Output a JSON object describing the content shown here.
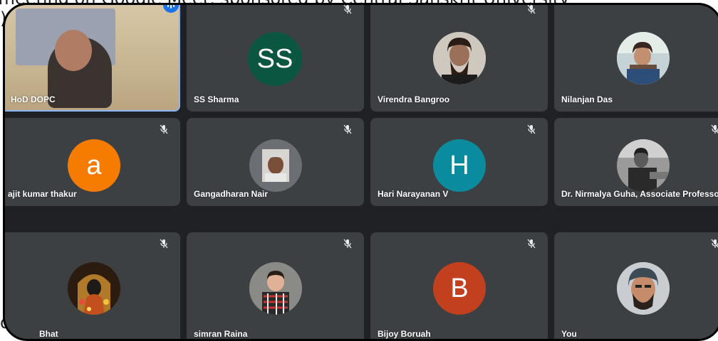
{
  "background_caption": {
    "top_line": "he meeting on Google Meet, sponsored by Central Sanskrit University",
    "left_fragment": "),",
    "bottom_fragment": "d"
  },
  "participants": [
    {
      "name": "HoD DOPC",
      "avatar": "video",
      "speaking": true
    },
    {
      "name": "SS Sharma",
      "avatar": "initials",
      "initials": "SS",
      "color": "#0b5640"
    },
    {
      "name": "Virendra Bangroo",
      "avatar": "photo-icon"
    },
    {
      "name": "Nilanjan Das",
      "avatar": "photo-icon"
    },
    {
      "name": "ajit kumar thakur",
      "avatar": "initials",
      "initials": "a",
      "color": "#f57c00"
    },
    {
      "name": "Gangadharan Nair",
      "avatar": "photo-icon"
    },
    {
      "name": "Hari Narayanan V",
      "avatar": "initials",
      "initials": "H",
      "color": "#0b8c9e"
    },
    {
      "name": "Dr. Nirmalya Guha, Associate Professor De...",
      "avatar": "photo-icon"
    },
    {
      "name": "Bhat",
      "avatar": "photo-icon"
    },
    {
      "name": "simran Raina",
      "avatar": "photo-icon"
    },
    {
      "name": "Bijoy Boruah",
      "avatar": "initials",
      "initials": "B",
      "color": "#c3401e"
    },
    {
      "name": "You",
      "avatar": "photo-icon"
    }
  ],
  "icons": {
    "muted": "mic-off-icon",
    "speaking": "audio-level-icon"
  },
  "colors": {
    "tile": "#3c4043",
    "grid": "#202124",
    "active_border": "#8ab4f8"
  }
}
